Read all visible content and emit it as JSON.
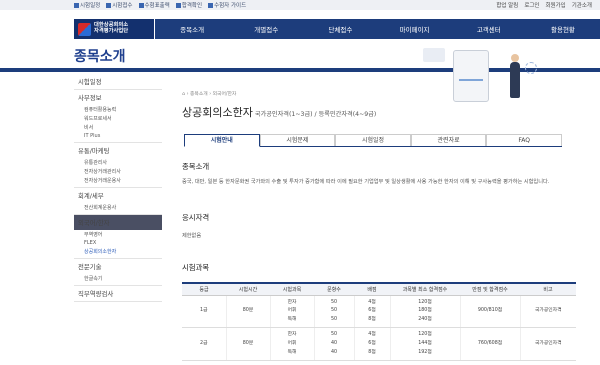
{
  "topbar": {
    "utils": [
      "시험일정",
      "시험접수",
      "수험표출력",
      "합격확인",
      "수험자 가이드"
    ],
    "right": [
      "합업 알림",
      "로그인",
      "회원가입",
      "기관소개"
    ]
  },
  "logo": {
    "line1": "대한상공회의소",
    "line2": "자격평가사업단"
  },
  "nav": [
    "종목소개",
    "개별접수",
    "단체접수",
    "마이페이지",
    "고객센터",
    "활용현황"
  ],
  "banner": {
    "title": "종목소개"
  },
  "sidebar": {
    "items": [
      {
        "label": "시험일정"
      },
      {
        "label": "사무정보",
        "subs": [
          "컴퓨터활용능력",
          "워드프로세서",
          "비서",
          "IT Plus"
        ]
      },
      {
        "label": "유통/마케팅",
        "subs": [
          "유통관리사",
          "전자상거래관리사",
          "전자상거래운용사"
        ]
      },
      {
        "label": "회계/세무",
        "subs": [
          "전산회계운용사"
        ]
      },
      {
        "label": "외국어/한자",
        "active": true,
        "subs": [
          "무역영어",
          "FLEX",
          "상공회의소한자"
        ],
        "active_sub": 2
      },
      {
        "label": "전문기술",
        "subs": [
          "한글속기"
        ]
      },
      {
        "label": "직무역량검사"
      }
    ]
  },
  "main": {
    "breadcrumb": "⌂ › 종목소개 › 외국어/한자",
    "title": "상공회의소한자",
    "subtitle": "국가공인자격(1~3급) / 등록민간자격(4~9급)",
    "tabs": [
      "시험안내",
      "시험문제",
      "시험일정",
      "관련자료",
      "FAQ"
    ],
    "section1": {
      "heading": "종목소개",
      "text": "중국, 대만, 일본 등 한자문화권 국가와의 수출 및 투자가 증가함에 따라 이에 필요한 기업업무 및 일상생활에 사용 가능한 한자의 이해 및 구사능력을 평가하는 시험입니다."
    },
    "section2": {
      "heading": "응시자격",
      "text": "제한없음"
    },
    "section3": {
      "heading": "시험과목"
    },
    "table": {
      "headers": [
        "등급",
        "시험시간",
        "시험과목",
        "문항수",
        "배점",
        "과목별 최소 합격점수",
        "만점 및 합격점수",
        "비고"
      ],
      "rows": [
        {
          "grade": "1급",
          "time": "80분",
          "subjects": [
            "한자",
            "어휘",
            "독해"
          ],
          "counts": [
            "50",
            "50",
            "50"
          ],
          "points": [
            "4점",
            "6점",
            "8점"
          ],
          "mins": [
            "120점",
            "180점",
            "240점"
          ],
          "score": "900/810점",
          "note": "국가공인자격"
        },
        {
          "grade": "2급",
          "time": "80분",
          "subjects": [
            "한자",
            "어휘",
            "독해"
          ],
          "counts": [
            "50",
            "40",
            "40"
          ],
          "points": [
            "4점",
            "6점",
            "8점"
          ],
          "mins": [
            "120점",
            "144점",
            "192점"
          ],
          "score": "760/608점",
          "note": "국가공인자격"
        }
      ]
    }
  }
}
